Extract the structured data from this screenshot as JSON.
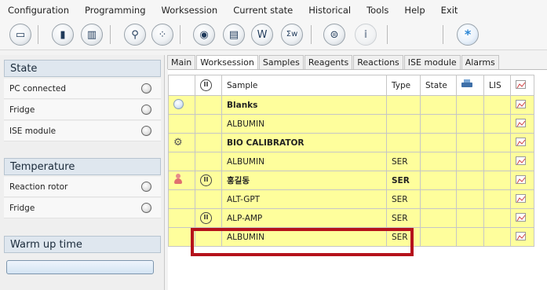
{
  "menu": [
    "Configuration",
    "Programming",
    "Worksession",
    "Current state",
    "Historical",
    "Tools",
    "Help",
    "Exit"
  ],
  "toolbar": {
    "buttons": [
      {
        "icon": "analyzer-icon",
        "glyph": "▭"
      },
      {
        "icon": "rotor-icon",
        "glyph": "▮"
      },
      {
        "icon": "rotor-samples-icon",
        "glyph": "▥"
      },
      {
        "icon": "tube-icon",
        "glyph": "⚲"
      },
      {
        "icon": "dots-ring-icon",
        "glyph": "⁘"
      },
      {
        "icon": "eye-icon",
        "glyph": "◉"
      },
      {
        "icon": "document-icon",
        "glyph": "▤"
      },
      {
        "icon": "w-icon",
        "glyph": "W"
      },
      {
        "icon": "sigma-w-icon",
        "glyph": "Σw"
      },
      {
        "icon": "database-icon",
        "glyph": "⊜"
      },
      {
        "icon": "info-icon",
        "glyph": "i"
      },
      {
        "icon": "asterisk-icon",
        "glyph": "*"
      }
    ]
  },
  "left": {
    "state_title": "State",
    "state_rows": [
      "PC connected",
      "Fridge",
      "ISE module"
    ],
    "temperature_title": "Temperature",
    "temperature_rows": [
      "Reaction rotor",
      "Fridge"
    ],
    "warmup_title": "Warm up time"
  },
  "tabs": [
    "Main",
    "Worksession",
    "Samples",
    "Reagents",
    "Reactions",
    "ISE module",
    "Alarms"
  ],
  "active_tab": "Worksession",
  "grid": {
    "headers": {
      "sample": "Sample",
      "type": "Type",
      "state": "State",
      "lis": "LIS"
    },
    "rows": [
      {
        "icon": "blank-icon",
        "status": "",
        "sample": "Blanks",
        "type": "",
        "bold": true
      },
      {
        "icon": "",
        "status": "",
        "sample": "ALBUMIN",
        "type": "",
        "bold": false
      },
      {
        "icon": "gear-icon",
        "status": "",
        "sample": "BIO CALIBRATOR",
        "type": "",
        "bold": true
      },
      {
        "icon": "",
        "status": "",
        "sample": "ALBUMIN",
        "type": "SER",
        "bold": false
      },
      {
        "icon": "person-icon",
        "status": "pause",
        "sample": "홍길동",
        "type": "SER",
        "bold": true
      },
      {
        "icon": "",
        "status": "",
        "sample": "ALT-GPT",
        "type": "SER",
        "bold": false
      },
      {
        "icon": "",
        "status": "pause",
        "sample": "ALP-AMP",
        "type": "SER",
        "bold": false
      },
      {
        "icon": "",
        "status": "",
        "sample": "ALBUMIN",
        "type": "SER",
        "bold": false
      }
    ]
  },
  "colors": {
    "row_bg": "#fefe9c",
    "highlight": "#b5121b",
    "section_header": "#dfe7ef"
  }
}
